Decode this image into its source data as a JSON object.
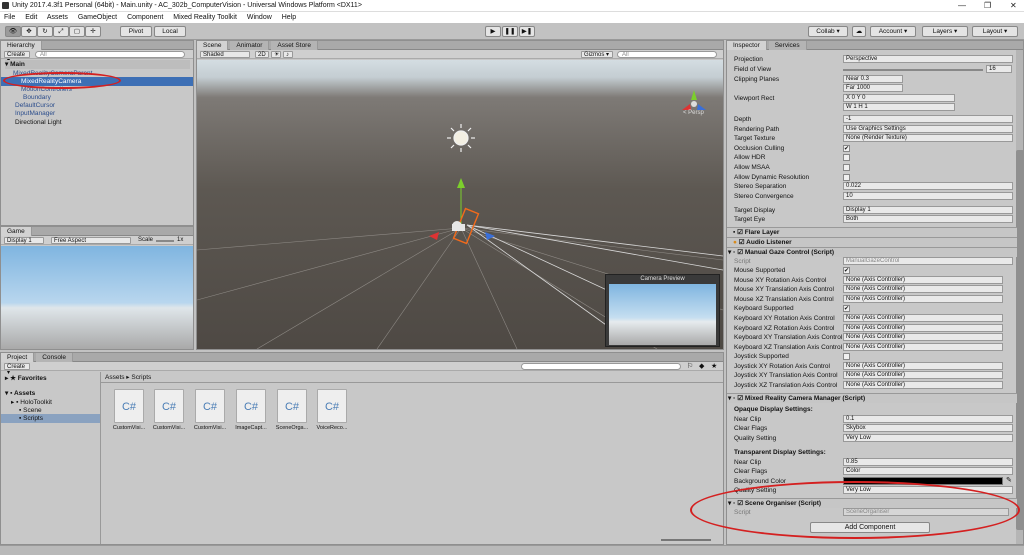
{
  "window": {
    "title": "Unity 2017.4.3f1 Personal (64bit) - Main.unity - AC_302b_ComputerVision - Universal Windows Platform <DX11>",
    "controls": [
      "—",
      "❐",
      "✕"
    ]
  },
  "menu": [
    "File",
    "Edit",
    "Assets",
    "GameObject",
    "Component",
    "Mixed Reality Toolkit",
    "Window",
    "Help"
  ],
  "toolbar": {
    "pivot": "Pivot",
    "local": "Local",
    "collab": "Collab ▾",
    "account": "Account ▾",
    "layers": "Layers ▾",
    "layout": "Layout ▾"
  },
  "hierarchy": {
    "tab": "Hierarchy",
    "create": "Create ▾",
    "search": "All",
    "scene": "Main",
    "items": [
      "MixedRealityCameraParent",
      "MixedRealityCamera",
      "MotionControllers",
      "Boundary",
      "DefaultCursor",
      "InputManager",
      "Directional Light"
    ]
  },
  "scene": {
    "tabs": [
      "Scene",
      "Animator",
      "Asset Store"
    ],
    "shaded": "Shaded",
    "mode2d": "2D",
    "gizmos": "Gizmos ▾",
    "search": "All",
    "persp": "< Persp",
    "preview_title": "Camera Preview"
  },
  "game": {
    "tab": "Game",
    "display": "Display 1",
    "aspect": "Free Aspect",
    "scale_label": "Scale",
    "scale_val": "1x"
  },
  "project": {
    "tabs": [
      "Project",
      "Console"
    ],
    "create": "Create ▾",
    "favorites": "Favorites",
    "assets": "Assets",
    "folders": [
      "HoloToolkit",
      "Scene",
      "Scripts"
    ],
    "breadcrumb": "Assets ▸ Scripts",
    "files": [
      "CustomVisi...",
      "CustomVisi...",
      "CustomVisi...",
      "ImageCapt...",
      "SceneOrga...",
      "VoiceReco..."
    ]
  },
  "inspector": {
    "tabs": [
      "Inspector",
      "Services"
    ],
    "camera": [
      {
        "label": "Projection",
        "value": "Perspective"
      },
      {
        "label": "Field of View",
        "value": "16"
      },
      {
        "label": "Clipping Planes",
        "value": "Near  0.3"
      },
      {
        "label": "",
        "value": "Far   1000"
      },
      {
        "label": "Viewport Rect",
        "value": "X 0        Y 0"
      },
      {
        "label": "",
        "value": "W 1        H 1"
      },
      {
        "label": "Depth",
        "value": "-1"
      },
      {
        "label": "Rendering Path",
        "value": "Use Graphics Settings"
      },
      {
        "label": "Target Texture",
        "value": "None (Render Texture)"
      },
      {
        "label": "Occlusion Culling",
        "value": "✔"
      },
      {
        "label": "Allow HDR",
        "value": ""
      },
      {
        "label": "Allow MSAA",
        "value": ""
      },
      {
        "label": "Allow Dynamic Resolution",
        "value": ""
      },
      {
        "label": "Stereo Separation",
        "value": "0.022"
      },
      {
        "label": "Stereo Convergence",
        "value": "10"
      },
      {
        "label": "Target Display",
        "value": "Display 1"
      },
      {
        "label": "Target Eye",
        "value": "Both"
      }
    ],
    "flare": "Flare Layer",
    "audio": "Audio Listener",
    "gaze": {
      "title": "Manual Gaze Control (Script)",
      "script": "ManualGazeControl",
      "rows": [
        {
          "label": "Script",
          "value": "ManualGazeControl"
        },
        {
          "label": "Mouse Supported",
          "value": "✔"
        },
        {
          "label": "Mouse XY Rotation Axis Control",
          "value": "None (Axis Controller)"
        },
        {
          "label": "Mouse XY Translation Axis Control",
          "value": "None (Axis Controller)"
        },
        {
          "label": "Mouse XZ Translation Axis Control",
          "value": "None (Axis Controller)"
        },
        {
          "label": "Keyboard Supported",
          "value": "✔"
        },
        {
          "label": "Keyboard XY Rotation Axis Control",
          "value": "None (Axis Controller)"
        },
        {
          "label": "Keyboard XZ Rotation Axis Control",
          "value": "None (Axis Controller)"
        },
        {
          "label": "Keyboard XY Translation Axis Control",
          "value": "None (Axis Controller)"
        },
        {
          "label": "Keyboard XZ Translation Axis Control",
          "value": "None (Axis Controller)"
        },
        {
          "label": "Joystick Supported",
          "value": ""
        },
        {
          "label": "Joystick XY Rotation Axis Control",
          "value": "None (Axis Controller)"
        },
        {
          "label": "Joystick XY Translation Axis Control",
          "value": "None (Axis Controller)"
        },
        {
          "label": "Joystick XZ Translation Axis Control",
          "value": "None (Axis Controller)"
        }
      ]
    },
    "mrcm": {
      "title": "Mixed Reality Camera Manager (Script)",
      "opaque": "Opaque Display Settings:",
      "trans": "Transparent Display Settings:",
      "rows1": [
        {
          "label": "Near Clip",
          "value": "0.1"
        },
        {
          "label": "Clear Flags",
          "value": "Skybox"
        },
        {
          "label": "Quality Setting",
          "value": "Very Low"
        }
      ],
      "rows2": [
        {
          "label": "Near Clip",
          "value": "0.85"
        },
        {
          "label": "Clear Flags",
          "value": "Color"
        },
        {
          "label": "Background Color",
          "value": ""
        },
        {
          "label": "Quality Setting",
          "value": "Very Low"
        }
      ]
    },
    "organiser": {
      "title": "Scene Organiser (Script)",
      "script_label": "Script",
      "script": "SceneOrganiser"
    },
    "add_component": "Add Component"
  }
}
